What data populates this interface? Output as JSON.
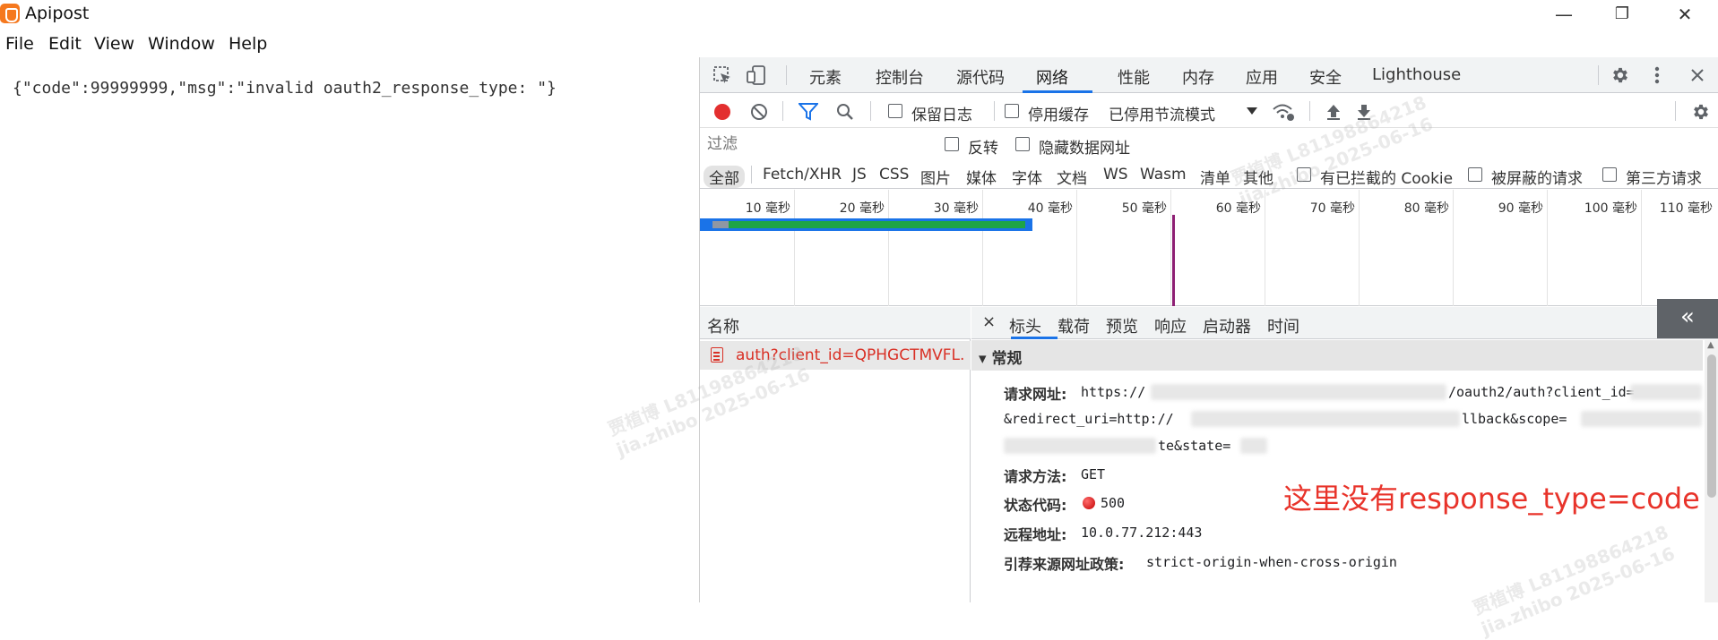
{
  "app": {
    "title": "Apipost"
  },
  "window_controls": {
    "minimize": "—",
    "maximize": "❐",
    "close": "✕"
  },
  "menu": [
    "File",
    "Edit",
    "View",
    "Window",
    "Help"
  ],
  "response_body": "{\"code\":99999999,\"msg\":\"invalid oauth2_response_type: \"}",
  "devtools": {
    "tabs": [
      "元素",
      "控制台",
      "源代码",
      "网络",
      "性能",
      "内存",
      "应用",
      "安全",
      "Lighthouse"
    ],
    "active_tab": "网络",
    "toolbar": {
      "preserve_log": "保留日志",
      "disable_cache": "停用缓存",
      "throttling": "已停用节流模式"
    },
    "filter": {
      "placeholder": "过滤",
      "invert": "反转",
      "hide_data_urls": "隐藏数据网址"
    },
    "types": [
      "全部",
      "Fetch/XHR",
      "JS",
      "CSS",
      "图片",
      "媒体",
      "字体",
      "文档",
      "WS",
      "Wasm",
      "清单",
      "其他"
    ],
    "type_checkboxes": [
      "有已拦截的 Cookie",
      "被屏蔽的请求",
      "第三方请求"
    ],
    "timeline_ticks": [
      "10 毫秒",
      "20 毫秒",
      "30 毫秒",
      "40 毫秒",
      "50 毫秒",
      "60 毫秒",
      "70 毫秒",
      "80 毫秒",
      "90 毫秒",
      "100 毫秒",
      "110 毫秒"
    ],
    "collapse_icon": "«",
    "requests": {
      "header": "名称",
      "items": [
        {
          "name": "auth?client_id=QPHGCTMVFL..."
        }
      ]
    },
    "details": {
      "close_icon": "×",
      "tabs": [
        "标头",
        "载荷",
        "预览",
        "响应",
        "启动器",
        "时间"
      ],
      "active_tab": "标头",
      "section": "▾ 常规",
      "fields": {
        "request_url_label": "请求网址:",
        "request_url_line1_a": "https://",
        "request_url_line1_b": "/oauth2/auth?client_id=",
        "request_url_line2_a": "&redirect_uri=http://",
        "request_url_line2_b": "llback&scope=",
        "request_url_line3": "te&state=",
        "method_label": "请求方法:",
        "method_value": "GET",
        "status_label": "状态代码:",
        "status_value": "500",
        "remote_label": "远程地址:",
        "remote_value": "10.0.77.212:443",
        "referrer_label": "引荐来源网址政策:",
        "referrer_value": "strict-origin-when-cross-origin"
      },
      "annotation": "这里没有response_type=code"
    }
  },
  "watermark": {
    "line1": "贾植博 L81198864218",
    "line2": "jia.zhibo 2025-06-16"
  },
  "colors": {
    "accent": "#1a73e8",
    "error": "#d93025",
    "annotation": "#e8332a",
    "brand": "#f5781e"
  }
}
